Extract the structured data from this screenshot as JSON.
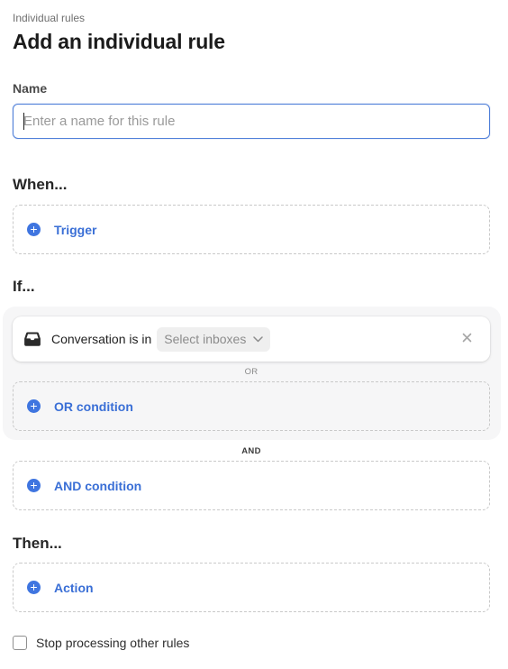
{
  "header": {
    "breadcrumb": "Individual rules",
    "title": "Add an individual rule"
  },
  "name_field": {
    "label": "Name",
    "value": "",
    "placeholder": "Enter a name for this rule"
  },
  "when": {
    "title": "When...",
    "trigger_label": "Trigger",
    "trigger_icon": "plus-circle-icon"
  },
  "if": {
    "title": "If...",
    "condition": {
      "icon": "inbox-tray-icon",
      "text": "Conversation is in",
      "select_value": "Select inboxes",
      "select_icon": "chevron-down-icon",
      "remove_icon": "close-icon"
    },
    "or_separator": "OR",
    "or_condition_label": "OR condition",
    "and_separator": "AND",
    "and_condition_label": "AND condition"
  },
  "then": {
    "title": "Then...",
    "action_label": "Action"
  },
  "options": {
    "stop_processing_label": "Stop processing other rules",
    "stop_processing_checked": false
  },
  "colors": {
    "accent": "#3f75e0",
    "link_text": "#3a6fd6",
    "focus_border": "#4f7fd9",
    "group_background": "#f6f6f7"
  }
}
